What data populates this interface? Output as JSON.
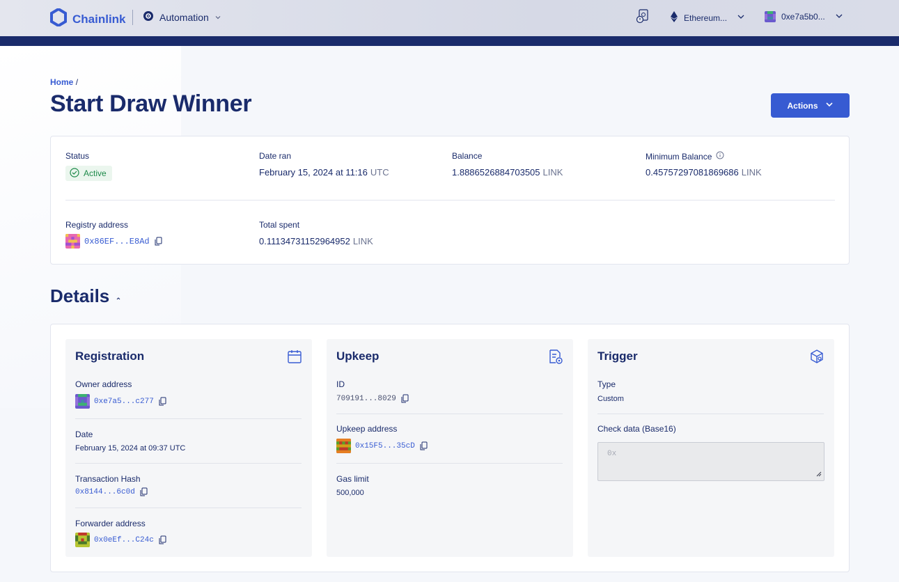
{
  "header": {
    "brand": "Chainlink",
    "product": "Automation",
    "network": "Ethereum...",
    "account": "0xe7a5b0..."
  },
  "breadcrumb": {
    "home": "Home",
    "separator": "/"
  },
  "page": {
    "title": "Start Draw Winner",
    "actions_label": "Actions"
  },
  "summary": {
    "status_label": "Status",
    "status_value": "Active",
    "date_ran_label": "Date ran",
    "date_ran_value": "February 15, 2024 at 11:16",
    "date_ran_tz": "UTC",
    "balance_label": "Balance",
    "balance_value": "1.8886526884703505",
    "balance_unit": "LINK",
    "min_balance_label": "Minimum Balance",
    "min_balance_value": "0.45757297081869686",
    "min_balance_unit": "LINK",
    "registry_label": "Registry address",
    "registry_value": "0x86EF...E8Ad",
    "total_spent_label": "Total spent",
    "total_spent_value": "0.11134731152964952",
    "total_spent_unit": "LINK"
  },
  "details": {
    "title": "Details",
    "registration": {
      "title": "Registration",
      "owner_label": "Owner address",
      "owner_value": "0xe7a5...c277",
      "date_label": "Date",
      "date_value": "February 15, 2024 at 09:37 UTC",
      "tx_label": "Transaction Hash",
      "tx_value": "0x8144...6c0d",
      "forwarder_label": "Forwarder address",
      "forwarder_value": "0x0eEf...C24c"
    },
    "upkeep": {
      "title": "Upkeep",
      "id_label": "ID",
      "id_value": "709191...8029",
      "address_label": "Upkeep address",
      "address_value": "0x15F5...35cD",
      "gas_label": "Gas limit",
      "gas_value": "500,000"
    },
    "trigger": {
      "title": "Trigger",
      "type_label": "Type",
      "type_value": "Custom",
      "checkdata_label": "Check data (Base16)",
      "checkdata_placeholder": "0x"
    }
  },
  "colors": {
    "brand": "#375bd2",
    "navy": "#1a2b6b",
    "active_green": "#1e8a4a"
  }
}
